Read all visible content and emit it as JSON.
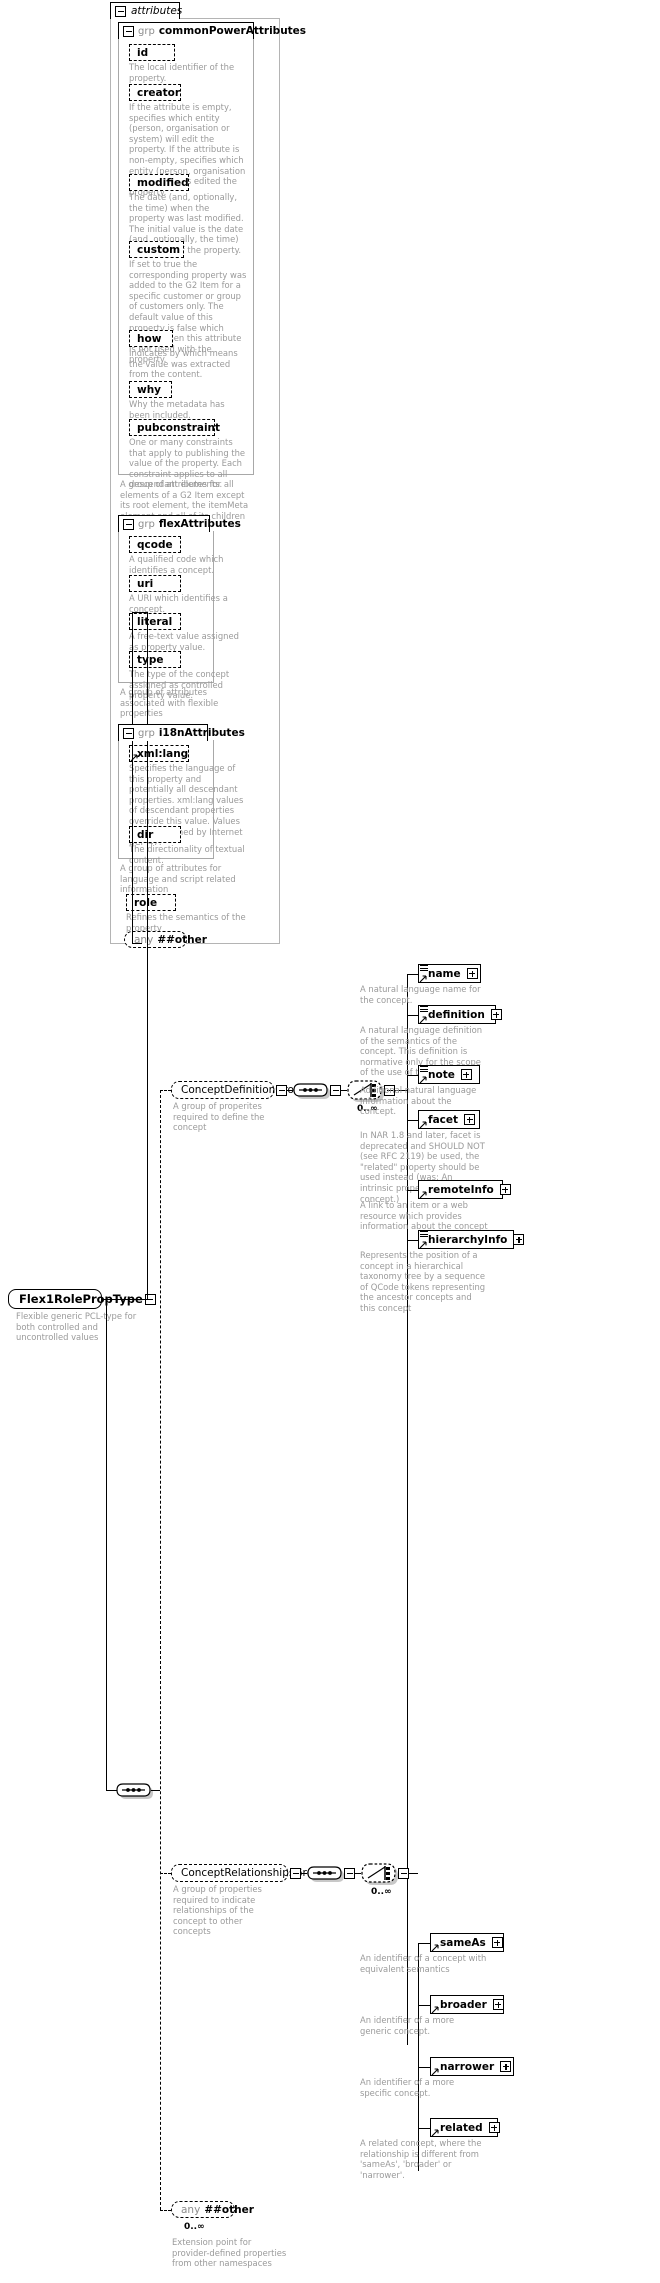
{
  "diagram": {
    "title": "Flex1RolePropType",
    "root": {
      "name": "Flex1RolePropType",
      "doc": "Flexible generic PCL-type for both controlled and uncontrolled values"
    },
    "attributes_panel": {
      "tab_label": "attributes",
      "groups": [
        {
          "keyword": "grp",
          "name": "commonPowerAttributes",
          "doc": "A group of attributes for all elements of a G2 Item except its root element, the itemMeta element and all of its children which are mandatory.",
          "attributes": [
            {
              "name": "id",
              "doc": "The local identifier of the property."
            },
            {
              "name": "creator",
              "doc": "If the attribute is empty, specifies which entity (person, organisation or system) will edit the property. If the attribute is non-empty, specifies which entity (person, organisation or system) has edited the property."
            },
            {
              "name": "modified",
              "doc": "The date (and, optionally, the time) when the property was last modified. The initial value is the date (and, optionally, the time) of creation of the property."
            },
            {
              "name": "custom",
              "doc": "If set to true the corresponding property was added to the G2 Item for a specific customer or group of customers only. The default value of this property is false which applies when this attribute is not used with the property."
            },
            {
              "name": "how",
              "doc": "Indicates by which means the value was extracted from the content."
            },
            {
              "name": "why",
              "doc": "Why the metadata has been included."
            },
            {
              "name": "pubconstraint",
              "doc": "One or many constraints that apply to publishing the value of the property. Each constraint applies to all descendant elements."
            }
          ]
        },
        {
          "keyword": "grp",
          "name": "flexAttributes",
          "doc": "A group of attributes associated with flexible properties",
          "attributes": [
            {
              "name": "qcode",
              "doc": "A qualified code which identifies a concept."
            },
            {
              "name": "uri",
              "doc": "A URI which identifies a concept."
            },
            {
              "name": "literal",
              "doc": "A free-text value assigned as property value."
            },
            {
              "name": "type",
              "doc": "The type of the concept assigned as controlled property value."
            }
          ]
        },
        {
          "keyword": "grp",
          "name": "i18nAttributes",
          "doc": "A group of attributes for language and script related information",
          "attributes": [
            {
              "name": "xml:lang",
              "doc": "Specifies the language of this property and potentially all descendant properties. xml:lang values of descendant properties override this value. Values are determined by Internet BCP 47."
            },
            {
              "name": "dir",
              "doc": "The directionality of textual content."
            }
          ]
        }
      ],
      "standalone_attributes": [
        {
          "name": "role",
          "doc": "Refines the semantics of the property"
        }
      ],
      "any": {
        "keyword": "any",
        "name": "##other",
        "doc": ""
      }
    },
    "content_model": {
      "sequence_label": "sequence",
      "branches": [
        {
          "group_ref": {
            "name": "ConceptDefinitionGroup",
            "doc": "A group of properites required to define the concept"
          },
          "occurrence": "0..∞",
          "elements": [
            {
              "name": "name",
              "doc": "A natural language name for the concept.",
              "expander": "plus",
              "seq_glyph": true,
              "arrow": true
            },
            {
              "name": "definition",
              "doc": "A natural language definition of the semantics of the concept. This definition is normative only for the scope of the use of this concept.",
              "expander": "plus",
              "seq_glyph": true,
              "arrow": true
            },
            {
              "name": "note",
              "doc": "Additional natural language information about the concept.",
              "expander": "plus",
              "seq_glyph": true,
              "arrow": true
            },
            {
              "name": "facet",
              "doc": "In NAR 1.8 and later, facet is deprecated and SHOULD NOT (see RFC 2119) be used, the \"related\" property should be used instead (was: An intrinsic property of the concept.)",
              "expander": "plus",
              "seq_glyph": false,
              "arrow": true
            },
            {
              "name": "remoteInfo",
              "doc": "A link to an item or a web resource which provides information about the concept",
              "expander": "plus",
              "seq_glyph": false,
              "arrow": true
            },
            {
              "name": "hierarchyInfo",
              "doc": "Represents the position of a concept in a hierarchical taxonomy tree by a sequence of QCode tokens representing the ancestor concepts and this concept",
              "expander": "plus",
              "seq_glyph": true,
              "arrow": true
            }
          ]
        },
        {
          "group_ref": {
            "name": "ConceptRelationshipsGroup",
            "doc": "A group of properties required to indicate relationships of the concept to other concepts"
          },
          "occurrence": "0..∞",
          "elements": [
            {
              "name": "sameAs",
              "doc": "An identifier of a concept with equivalent semantics",
              "expander": "plus",
              "seq_glyph": false,
              "arrow": true
            },
            {
              "name": "broader",
              "doc": "An identifier of a more generic concept.",
              "expander": "plus",
              "seq_glyph": false,
              "arrow": true
            },
            {
              "name": "narrower",
              "doc": "An identifier of a more specific concept.",
              "expander": "plus",
              "seq_glyph": false,
              "arrow": true
            },
            {
              "name": "related",
              "doc": "A related concept, where the relationship is different from 'sameAs', 'broader' or 'narrower'.",
              "expander": "plus",
              "seq_glyph": false,
              "arrow": true
            }
          ]
        },
        {
          "any": {
            "keyword": "any",
            "name": "##other",
            "occurrence": "0..∞",
            "doc": "Extension point for provider-defined properties from other namespaces"
          }
        }
      ]
    },
    "colors": {
      "line": "#000000",
      "doc_text": "#9a9a9a",
      "shadow": "#c8c8c8",
      "container_border": "#a8a8a8",
      "keyword": "#8d8d8d"
    }
  }
}
